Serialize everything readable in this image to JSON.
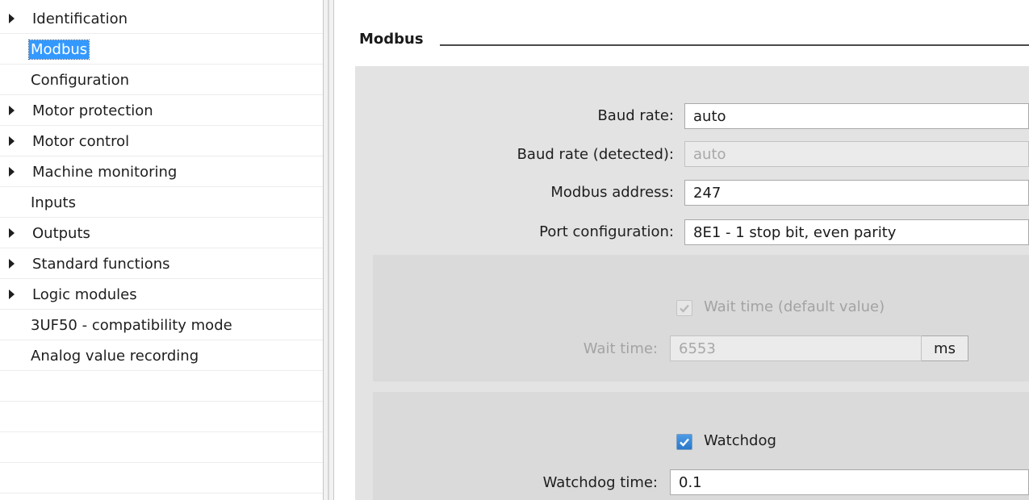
{
  "nav": {
    "items": [
      {
        "label": "Identification",
        "arrow": true
      },
      {
        "label": "Modbus",
        "arrow": false,
        "selected": true
      },
      {
        "label": "Configuration",
        "arrow": false
      },
      {
        "label": "Motor protection",
        "arrow": true
      },
      {
        "label": "Motor control",
        "arrow": true
      },
      {
        "label": "Machine monitoring",
        "arrow": true
      },
      {
        "label": "Inputs",
        "arrow": false
      },
      {
        "label": "Outputs",
        "arrow": true
      },
      {
        "label": "Standard functions",
        "arrow": true
      },
      {
        "label": "Logic modules",
        "arrow": true
      },
      {
        "label": "3UF50 - compatibility mode",
        "arrow": false
      },
      {
        "label": "Analog value recording",
        "arrow": false
      }
    ]
  },
  "section": {
    "title": "Modbus"
  },
  "fields": {
    "baud_rate": {
      "label": "Baud rate:",
      "value": "auto"
    },
    "baud_rate_detected": {
      "label": "Baud rate (detected):",
      "value": "auto"
    },
    "modbus_address": {
      "label": "Modbus address:",
      "value": "247"
    },
    "port_configuration": {
      "label": "Port configuration:",
      "value": "8E1 - 1 stop bit, even parity"
    }
  },
  "wait": {
    "checkbox_label": "Wait time (default value)",
    "checked": true,
    "time_label": "Wait time:",
    "time_value": "6553",
    "unit": "ms"
  },
  "watchdog": {
    "checkbox_label": "Watchdog",
    "checked": true,
    "time_label": "Watchdog time:",
    "time_value": "0.1"
  },
  "colors": {
    "selection": "#3399ff",
    "panel": "#e3e3e3",
    "subpanel": "#dadada",
    "checkbox": "#2a78c9"
  },
  "icons": {
    "tree_expand": "triangle-right-icon",
    "check": "checkmark-icon"
  }
}
